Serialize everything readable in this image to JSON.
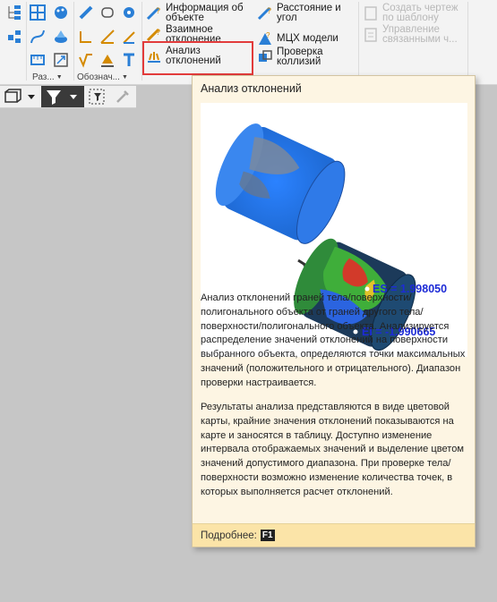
{
  "ribbon": {
    "groups": [
      {
        "label": "Раз...",
        "arrow": "▼"
      },
      {
        "label": "Обознач...",
        "arrow": "▼"
      }
    ],
    "buttons": {
      "info_object": "Информация об объекте",
      "distance_angle": "Расстояние и угол",
      "mutual_deviation": "Взаимное отклонение",
      "mass_properties": "МЦХ модели",
      "deviation_analysis": "Анализ отклонений",
      "collision_check": "Проверка коллизий",
      "create_drawing": "Создать чертеж по шаблону",
      "manage_linked": "Управление связанными ч..."
    }
  },
  "tooltip": {
    "title": "Анализ отклонений",
    "image_labels": {
      "es": "ES = 1.998050",
      "ei": "EI = -1.990665"
    },
    "paragraph1": "Анализ отклонений граней тела/поверхности/полигонального объекта от граней другого тела/поверхности/полигонального объекта. Анализируется распределение значений отклонений на поверхности выбранного объекта, определяются точки максимальных значений (положительного и отрицательного). Диапазон проверки настраивается.",
    "paragraph2": "Результаты анализа представляются в виде цветовой карты, крайние значения отклонений показываются на карте и заносятся в таблицу. Доступно изменение интервала отображаемых значений и выделение цветом значений допустимого диапазона. При проверке тела/поверхности возможно изменение количества точек, в которых выполняется расчет отклонений.",
    "footer_more": "Подробнее:",
    "footer_key": "F1"
  },
  "colors": {
    "tooltip_bg": "#fdf5e3",
    "footer_bg": "#fbe4a8",
    "highlight": "#e23b3b",
    "label_blue": "#1d2bd6"
  }
}
